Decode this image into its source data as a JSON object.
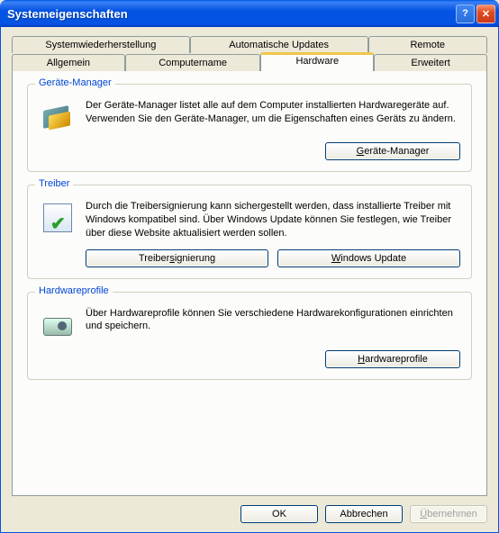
{
  "window": {
    "title": "Systemeigenschaften"
  },
  "tabs": {
    "row1": [
      {
        "label": "Systemwiederherstellung"
      },
      {
        "label": "Automatische Updates"
      },
      {
        "label": "Remote"
      }
    ],
    "row2": [
      {
        "label": "Allgemein"
      },
      {
        "label": "Computername"
      },
      {
        "label": "Hardware",
        "active": true
      },
      {
        "label": "Erweitert"
      }
    ]
  },
  "groups": {
    "devmgr": {
      "title": "Geräte-Manager",
      "desc": "Der Geräte-Manager listet alle auf dem Computer installierten Hardwaregeräte auf. Verwenden Sie den Geräte-Manager, um die Eigenschaften eines Geräts zu ändern.",
      "button": "Geräte-Manager"
    },
    "drivers": {
      "title": "Treiber",
      "desc": "Durch die Treibersignierung kann sichergestellt werden, dass installierte Treiber mit Windows kompatibel sind. Über Windows Update können Sie festlegen, wie Treiber über diese Website aktualisiert werden sollen.",
      "button_signing": "Treibersignierung",
      "button_wu": "Windows Update"
    },
    "hwprof": {
      "title": "Hardwareprofile",
      "desc": "Über Hardwareprofile können Sie verschiedene Hardware­konfigurationen einrichten und speichern.",
      "button": "Hardwareprofile"
    }
  },
  "dialog_buttons": {
    "ok": "OK",
    "cancel": "Abbrechen",
    "apply": "Übernehmen"
  }
}
